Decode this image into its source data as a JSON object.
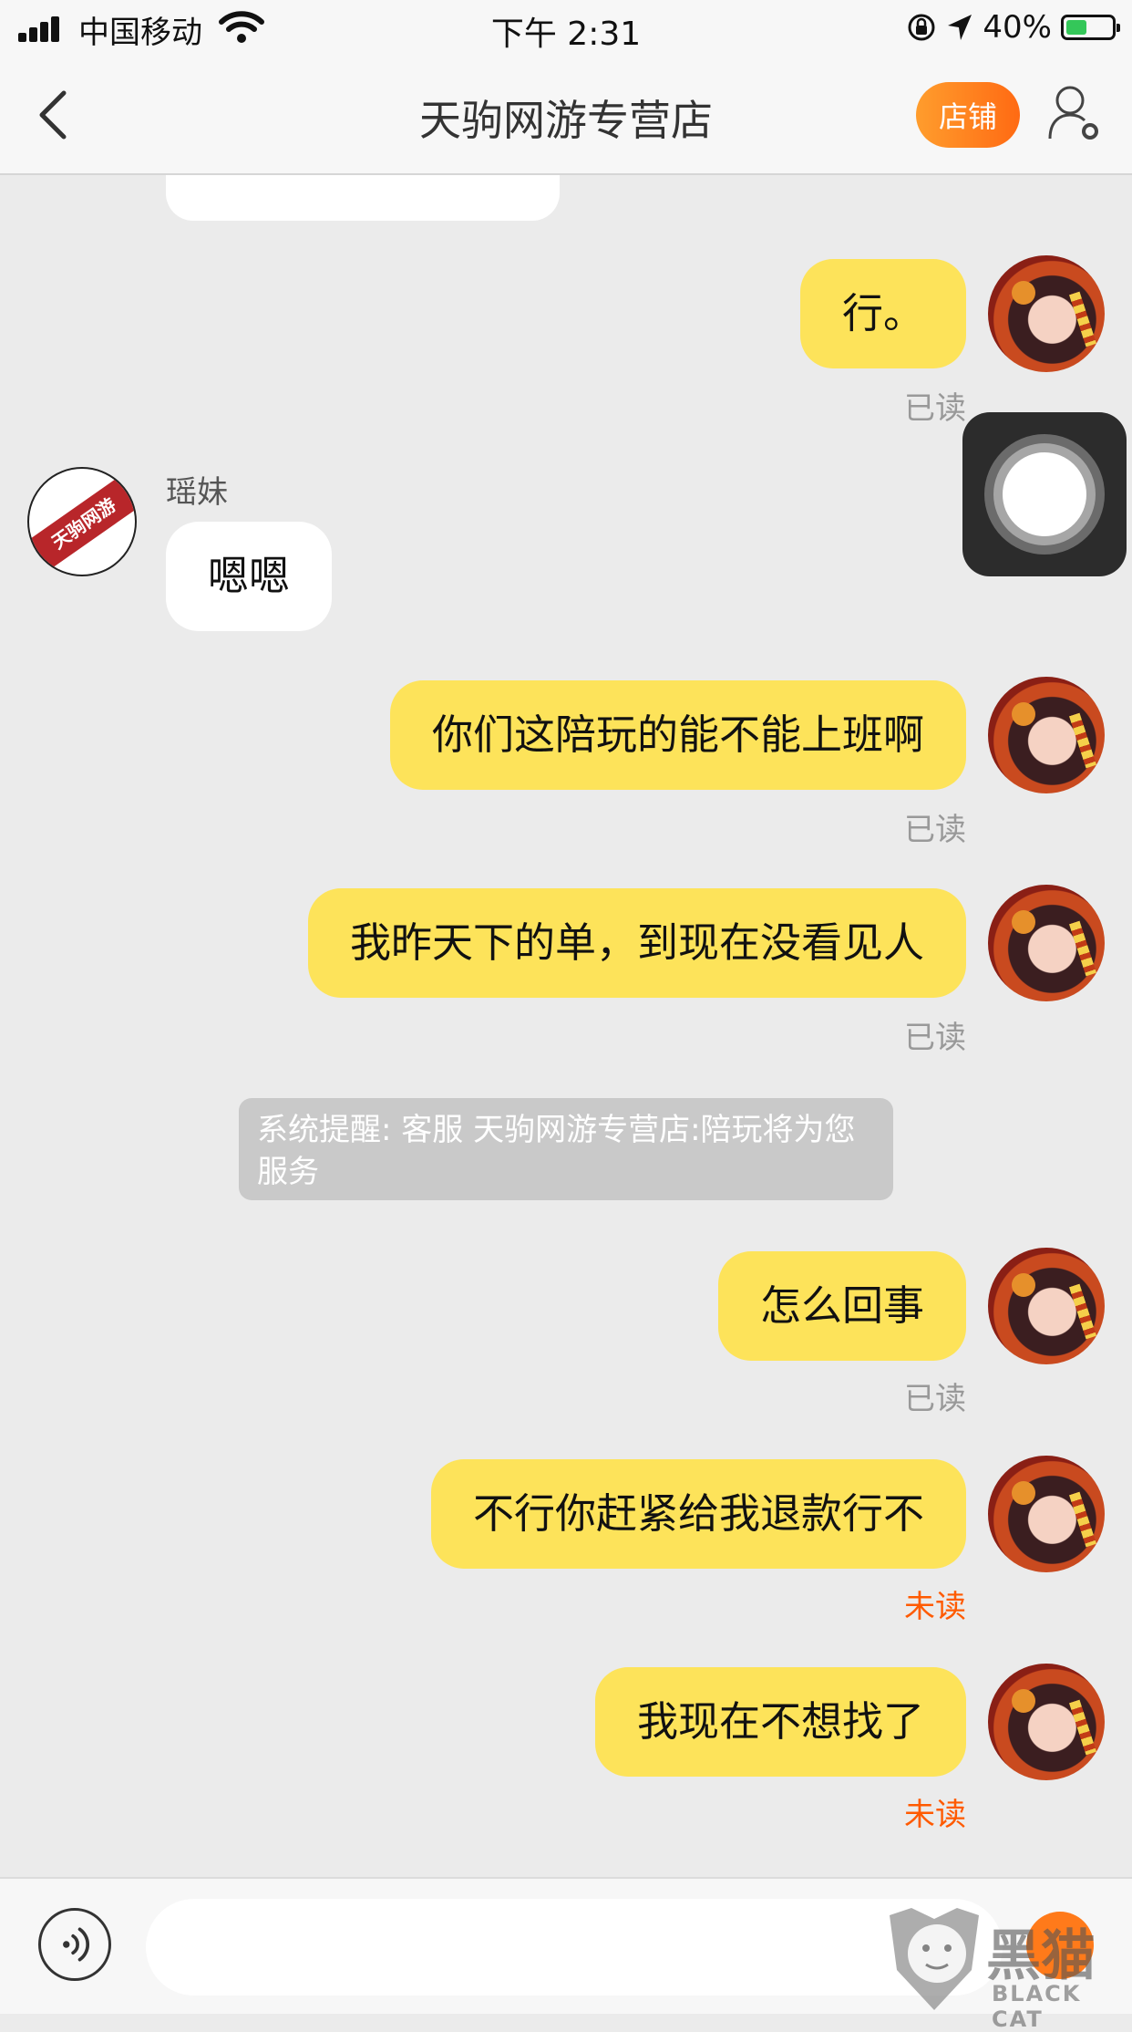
{
  "status_bar": {
    "carrier": "中国移动",
    "time": "下午 2:31",
    "battery": "40%"
  },
  "nav": {
    "title": "天驹网游专营店",
    "shop_button": "店铺"
  },
  "shop": {
    "sender_name": "瑶妹",
    "avatar_text": "天驹网游"
  },
  "messages": {
    "m1": "行。",
    "m1_status": "已读",
    "m2": "嗯嗯",
    "m3": "你们这陪玩的能不能上班啊",
    "m3_status": "已读",
    "m4": "我昨天下的单，到现在没看见人",
    "m4_status": "已读",
    "system": "系统提醒: 客服 天驹网游专营店:陪玩将为您服务",
    "m5": "怎么回事",
    "m5_status": "已读",
    "m6": "不行你赶紧给我退款行不",
    "m6_status": "未读",
    "m7": "我现在不想找了",
    "m7_status": "未读"
  },
  "input": {
    "placeholder": ""
  },
  "watermark": {
    "text_cn": "黑猫",
    "text_en": "BLACK CAT"
  },
  "colors": {
    "my_bubble": "#fde35a",
    "unread": "#ff5a00",
    "shop_button": "#ff7a1a"
  }
}
